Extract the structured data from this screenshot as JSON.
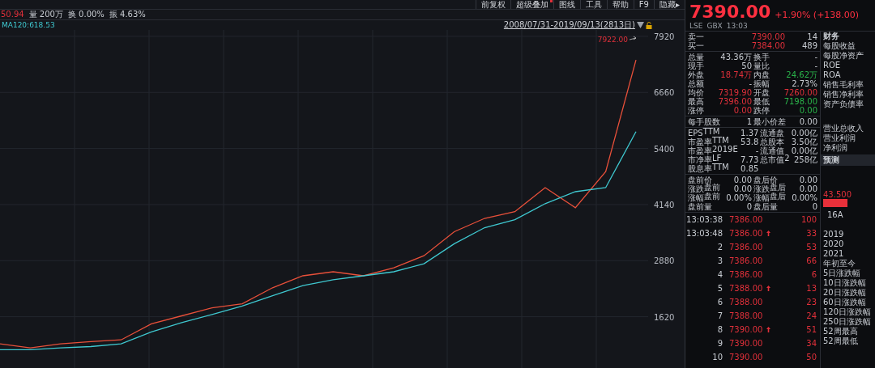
{
  "toolbar": [
    {
      "label": "前复权",
      "dot": false
    },
    {
      "label": "超级叠加",
      "dot": true
    },
    {
      "label": "图线",
      "dot": false
    },
    {
      "label": "工具",
      "dot": false
    },
    {
      "label": "帮助",
      "dot": false
    },
    {
      "label": "F9",
      "dot": false
    },
    {
      "label": "隐藏▸",
      "dot": false
    }
  ],
  "info": [
    {
      "text": "50.94",
      "color": "#e0303a"
    },
    {
      "text": "量 200万"
    },
    {
      "text": "换 0.00%"
    },
    {
      "text": "振 4.63%"
    }
  ],
  "ma_legend": "MA120:618.53",
  "date_range": "2008/07/31-2019/09/13(2813日)",
  "chart": {
    "chart_data": {
      "type": "line",
      "grid": true,
      "series": [
        {
          "color": "#e8503a",
          "values": [
            1010,
            920,
            1010,
            1060,
            1100,
            1460,
            1640,
            1820,
            1910,
            2270,
            2540,
            2630,
            2540,
            2720,
            2990,
            3530,
            3830,
            3980,
            4520,
            4070,
            4880,
            7390
          ]
        },
        {
          "color": "#3fc8d0",
          "values": [
            880,
            880,
            920,
            950,
            1010,
            1280,
            1490,
            1670,
            1860,
            2090,
            2320,
            2450,
            2540,
            2630,
            2810,
            3260,
            3620,
            3800,
            4160,
            4430,
            4520,
            5780
          ]
        }
      ],
      "ylim": [
        468,
        8064
      ],
      "yticks": [
        1620,
        2880,
        4140,
        5400,
        6660,
        7920
      ],
      "annotations": [
        {
          "text": "7922.00"
        }
      ]
    }
  },
  "quote": {
    "price": "7390.00",
    "change": "+1.90% (+138.00)",
    "meta": [
      "LSE",
      "GBX",
      "13:03"
    ]
  },
  "order_book": [
    {
      "label": "卖一",
      "price": "7390.00",
      "volume": "14"
    },
    {
      "label": "买一",
      "price": "7384.00",
      "volume": "489"
    }
  ],
  "stats": [
    [
      [
        {
          "label": "总量",
          "value": "43.36万"
        },
        {
          "label": "换手",
          "value": "-"
        }
      ],
      [
        {
          "label": "现手",
          "value": "50"
        },
        {
          "label": "量比",
          "value": "-"
        }
      ],
      [
        {
          "label": "外盘",
          "value": "18.74万",
          "color": "#e0303a"
        },
        {
          "label": "内盘",
          "value": "24.62万",
          "color": "#2ab44a"
        }
      ],
      [
        {
          "label": "总额",
          "value": "-"
        },
        {
          "label": "振幅",
          "value": "2.73%"
        }
      ],
      [
        {
          "label": "均价",
          "value": "7319.90",
          "color": "#e0303a"
        },
        {
          "label": "开盘",
          "value": "7260.00",
          "color": "#e0303a"
        }
      ],
      [
        {
          "label": "最高",
          "value": "7396.00",
          "color": "#e0303a"
        },
        {
          "label": "最低",
          "value": "7198.00",
          "color": "#2ab44a"
        }
      ],
      [
        {
          "label": "涨停",
          "value": "0.00",
          "color": "#e0303a"
        },
        {
          "label": "跌停",
          "value": "0.00",
          "color": "#2ab44a"
        }
      ]
    ],
    [
      [
        {
          "label": "每手股数",
          "value": "1"
        },
        {
          "label": "最小价差",
          "value": "0.00"
        }
      ]
    ],
    [
      [
        {
          "label": "EPS$^{TTM}$",
          "value": "1.37"
        },
        {
          "label": "流通盘",
          "value": "0.00亿"
        }
      ],
      [
        {
          "label": "市盈率$^{TTM}$",
          "value": "53.8"
        },
        {
          "label": "总股本",
          "value": "3.50亿"
        }
      ],
      [
        {
          "label": "市盈率$^{2019E}$",
          "value": "-"
        },
        {
          "label": "流通值",
          "value": "0.00亿"
        }
      ],
      [
        {
          "label": "市净率$^{LF}$",
          "value": "7.73"
        },
        {
          "label": "总市值$^{2}$",
          "value": "258亿"
        }
      ],
      [
        {
          "label": "股息率$^{TTM}$",
          "value": "0.85"
        }
      ]
    ],
    [
      [
        {
          "label": "盘前价",
          "value": "0.00"
        },
        {
          "label": "盘后价",
          "value": "0.00"
        }
      ],
      [
        {
          "label": "涨跌$^{盘前}$",
          "value": "0.00"
        },
        {
          "label": "涨跌$^{盘后}$",
          "value": "0.00"
        }
      ],
      [
        {
          "label": "涨幅$^{盘前}$",
          "value": "0.00%"
        },
        {
          "label": "涨幅$^{盘后}$",
          "value": "0.00%"
        }
      ],
      [
        {
          "label": "盘前量",
          "value": "0"
        },
        {
          "label": "盘后量",
          "value": "0"
        }
      ]
    ]
  ],
  "ticks": [
    {
      "time": "13:03:38",
      "price": "7386.00",
      "volume": "100",
      "up": false
    },
    {
      "time": "13:03:48",
      "price": "7386.00",
      "volume": "33",
      "up": true
    },
    {
      "time": "2",
      "price": "7386.00",
      "volume": "53",
      "up": false
    },
    {
      "time": "3",
      "price": "7386.00",
      "volume": "66",
      "up": false
    },
    {
      "time": "4",
      "price": "7386.00",
      "volume": "6",
      "up": false
    },
    {
      "time": "5",
      "price": "7388.00",
      "volume": "13",
      "up": true
    },
    {
      "time": "6",
      "price": "7388.00",
      "volume": "23",
      "up": false
    },
    {
      "time": "7",
      "price": "7388.00",
      "volume": "24",
      "up": false
    },
    {
      "time": "8",
      "price": "7390.00",
      "volume": "51",
      "up": true
    },
    {
      "time": "9",
      "price": "7390.00",
      "volume": "34",
      "up": false
    },
    {
      "time": "10",
      "price": "7390.00",
      "volume": "50",
      "up": false
    }
  ],
  "finance": [
    {
      "kind": "header",
      "text": "财务"
    },
    {
      "kind": "item",
      "text": "每股收益"
    },
    {
      "kind": "item",
      "text": "每股净资产"
    },
    {
      "kind": "item",
      "text": "ROE"
    },
    {
      "kind": "item",
      "text": "ROA"
    },
    {
      "kind": "item",
      "text": "销售毛利率"
    },
    {
      "kind": "item",
      "text": "销售净利率"
    },
    {
      "kind": "item",
      "text": "资产负债率"
    },
    {
      "kind": "group-start",
      "text": "营业总收入"
    },
    {
      "kind": "item",
      "text": "营业利润"
    },
    {
      "kind": "item",
      "text": "净利润"
    },
    {
      "kind": "panel-header",
      "text": "预测"
    },
    {
      "kind": "bar",
      "text": "43.500"
    },
    {
      "kind": "label",
      "text": "16A"
    },
    {
      "kind": "group-start",
      "text": "2019"
    },
    {
      "kind": "item",
      "text": "2020"
    },
    {
      "kind": "item",
      "text": "2021"
    },
    {
      "kind": "item",
      "text": "年初至今"
    },
    {
      "kind": "item",
      "text": "5日涨跌幅"
    },
    {
      "kind": "item",
      "text": "10日涨跌幅"
    },
    {
      "kind": "item",
      "text": "20日涨跌幅"
    },
    {
      "kind": "item",
      "text": "60日涨跌幅"
    },
    {
      "kind": "item",
      "text": "120日涨跌幅"
    },
    {
      "kind": "item",
      "text": "250日涨跌幅"
    },
    {
      "kind": "item",
      "text": "52周最高"
    },
    {
      "kind": "item",
      "text": "52周最低"
    }
  ]
}
